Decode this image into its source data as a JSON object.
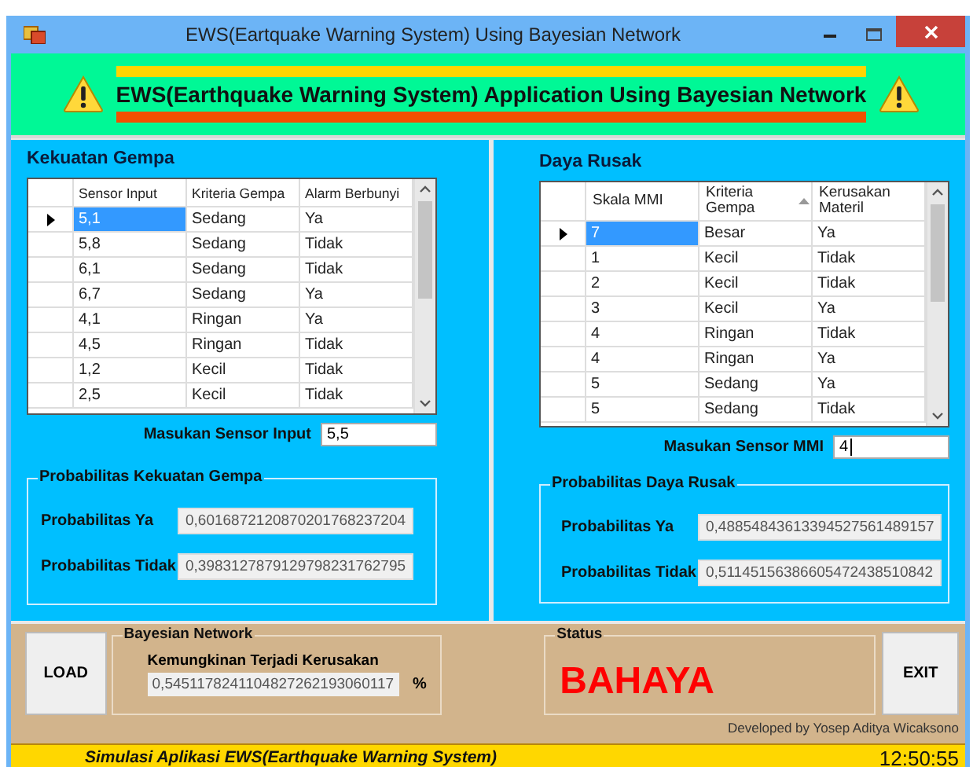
{
  "window": {
    "title": "EWS(Eartquake Warning System) Using Bayesian Network"
  },
  "banner": {
    "title": "EWS(Earthquake Warning System) Application Using Bayesian Network"
  },
  "panels": [
    {
      "title": "Kekuatan Gempa",
      "table": {
        "columns": [
          {
            "label": "Sensor Input",
            "sorted": false
          },
          {
            "label": "Kriteria Gempa",
            "sorted": false
          },
          {
            "label": "Alarm Berbunyi",
            "sorted": false
          }
        ],
        "rows": [
          {
            "cells": [
              "5,1",
              "Sedang",
              "Ya"
            ],
            "selected": true
          },
          {
            "cells": [
              "5,8",
              "Sedang",
              "Tidak"
            ],
            "selected": false
          },
          {
            "cells": [
              "6,1",
              "Sedang",
              "Tidak"
            ],
            "selected": false
          },
          {
            "cells": [
              "6,7",
              "Sedang",
              "Ya"
            ],
            "selected": false
          },
          {
            "cells": [
              "4,1",
              "Ringan",
              "Ya"
            ],
            "selected": false
          },
          {
            "cells": [
              "4,5",
              "Ringan",
              "Tidak"
            ],
            "selected": false
          },
          {
            "cells": [
              "1,2",
              "Kecil",
              "Tidak"
            ],
            "selected": false
          },
          {
            "cells": [
              "2,5",
              "Kecil",
              "Tidak"
            ],
            "selected": false
          }
        ]
      },
      "input": {
        "label": "Masukan Sensor Input",
        "value": "5,5",
        "focused": false
      },
      "group": {
        "title": "Probabilitas Kekuatan Gempa",
        "rows": [
          {
            "label": "Probabilitas Ya",
            "value": "0,6016872120870201768237204"
          },
          {
            "label": "Probabilitas Tidak",
            "value": "0,3983127879129798231762795"
          }
        ]
      }
    },
    {
      "title": "Daya Rusak",
      "table": {
        "columns": [
          {
            "label": "Skala MMI",
            "sorted": false
          },
          {
            "label": "Kriteria Gempa",
            "sorted": true
          },
          {
            "label": "Kerusakan Materil",
            "sorted": false
          }
        ],
        "rows": [
          {
            "cells": [
              "7",
              "Besar",
              "Ya"
            ],
            "selected": true
          },
          {
            "cells": [
              "1",
              "Kecil",
              "Tidak"
            ],
            "selected": false
          },
          {
            "cells": [
              "2",
              "Kecil",
              "Tidak"
            ],
            "selected": false
          },
          {
            "cells": [
              "3",
              "Kecil",
              "Ya"
            ],
            "selected": false
          },
          {
            "cells": [
              "4",
              "Ringan",
              "Tidak"
            ],
            "selected": false
          },
          {
            "cells": [
              "4",
              "Ringan",
              "Ya"
            ],
            "selected": false
          },
          {
            "cells": [
              "5",
              "Sedang",
              "Ya"
            ],
            "selected": false
          },
          {
            "cells": [
              "5",
              "Sedang",
              "Tidak"
            ],
            "selected": false
          }
        ]
      },
      "input": {
        "label": "Masukan Sensor MMI",
        "value": "4",
        "focused": true
      },
      "group": {
        "title": "Probabilitas Daya Rusak",
        "rows": [
          {
            "label": "Probabilitas Ya",
            "value": "0,48854843613394527561489157"
          },
          {
            "label": "Probabilitas Tidak",
            "value": "0,51145156386605472438510842"
          }
        ]
      }
    }
  ],
  "bottom": {
    "load_button": "LOAD",
    "bayesian": {
      "title": "Bayesian Network",
      "label": "Kemungkinan Terjadi Kerusakan",
      "value": "0,5451178241104827262193060117",
      "unit": "%"
    },
    "status": {
      "title": "Status",
      "value": "BAHAYA"
    },
    "exit_button": "EXIT",
    "credit": "Developed by Yosep Aditya Wicaksono"
  },
  "status_bar": {
    "text": "Simulasi Aplikasi EWS(Earthquake Warning System)",
    "time": "12:50:55"
  }
}
